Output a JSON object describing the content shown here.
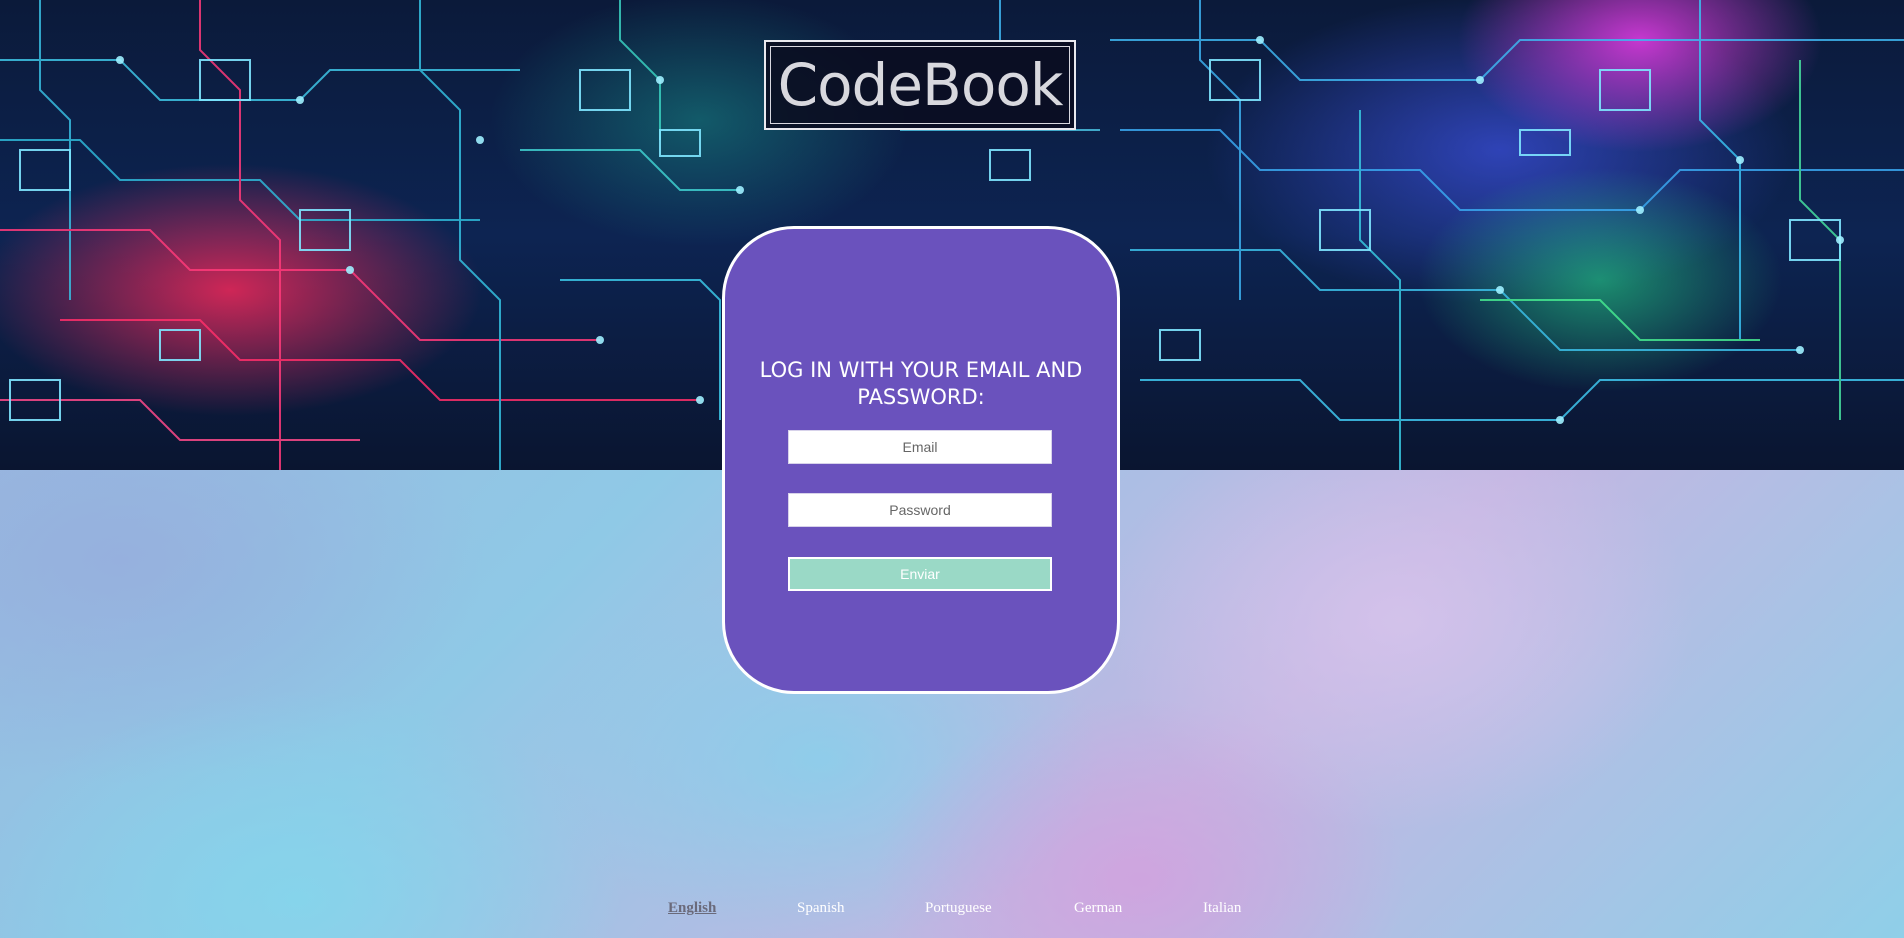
{
  "brand": {
    "logo_text": "CodeBook"
  },
  "login": {
    "title": "LOG IN WITH YOUR EMAIL AND PASSWORD:",
    "email_placeholder": "Email",
    "password_placeholder": "Password",
    "submit_label": "Enviar"
  },
  "languages": {
    "selected": "English",
    "items": [
      {
        "label": "English"
      },
      {
        "label": "Spanish"
      },
      {
        "label": "Portuguese"
      },
      {
        "label": "German"
      },
      {
        "label": "Italian"
      }
    ]
  },
  "colors": {
    "card_background": "#6a52bd",
    "submit_button": "#9ad9c6",
    "card_border": "#ffffff"
  },
  "icons": {
    "banner": "circuit-board-image"
  }
}
